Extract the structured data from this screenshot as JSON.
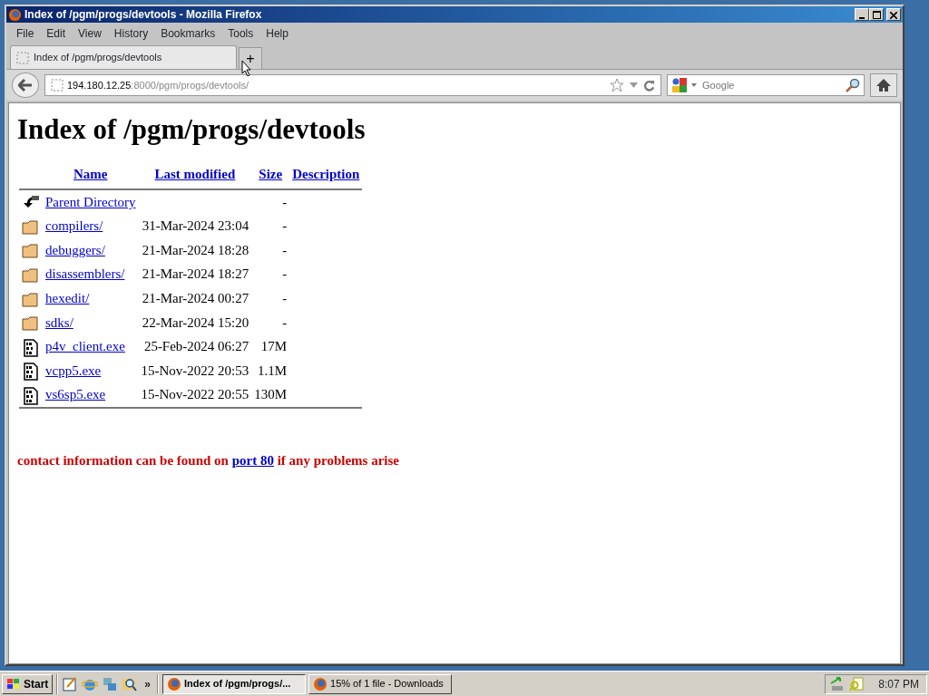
{
  "window": {
    "title": "Index of /pgm/progs/devtools - Mozilla Firefox"
  },
  "menu": [
    "File",
    "Edit",
    "View",
    "History",
    "Bookmarks",
    "Tools",
    "Help"
  ],
  "tabs": [
    {
      "label": "Index of /pgm/progs/devtools",
      "selected": true
    }
  ],
  "new_tab": "+",
  "address": {
    "host": "194.180.12.25",
    "rest": ":8000/pgm/progs/devtools/"
  },
  "search": {
    "placeholder": "Google"
  },
  "page": {
    "heading": "Index of /pgm/progs/devtools",
    "columns": [
      "Name",
      "Last modified",
      "Size",
      "Description"
    ],
    "rows": [
      {
        "kind": "parent",
        "name": "Parent Directory",
        "modified": "",
        "size": "-"
      },
      {
        "kind": "folder",
        "name": "compilers/",
        "modified": "31-Mar-2024 23:04",
        "size": "-"
      },
      {
        "kind": "folder",
        "name": "debuggers/",
        "modified": "21-Mar-2024 18:28",
        "size": "-"
      },
      {
        "kind": "folder",
        "name": "disassemblers/",
        "modified": "21-Mar-2024 18:27",
        "size": "-"
      },
      {
        "kind": "folder",
        "name": "hexedit/",
        "modified": "21-Mar-2024 00:27",
        "size": "-"
      },
      {
        "kind": "folder",
        "name": "sdks/",
        "modified": "22-Mar-2024 15:20",
        "size": "-"
      },
      {
        "kind": "binary",
        "name": "p4v_client.exe",
        "modified": "25-Feb-2024 06:27",
        "size": "17M"
      },
      {
        "kind": "binary",
        "name": "vcpp5.exe",
        "modified": "15-Nov-2022 20:53",
        "size": "1.1M"
      },
      {
        "kind": "binary",
        "name": "vs6sp5.exe",
        "modified": "15-Nov-2022 20:55",
        "size": "130M"
      }
    ],
    "footer": {
      "before": "contact information can be found on",
      "link": "port 80",
      "after": "if any problems arise"
    }
  },
  "taskbar": {
    "start": "Start",
    "more": "»",
    "tasks": [
      {
        "label": "Index of /pgm/progs/...",
        "selected": true
      },
      {
        "label": "15% of 1 file - Downloads",
        "selected": false
      }
    ],
    "clock": "8:07 PM"
  }
}
